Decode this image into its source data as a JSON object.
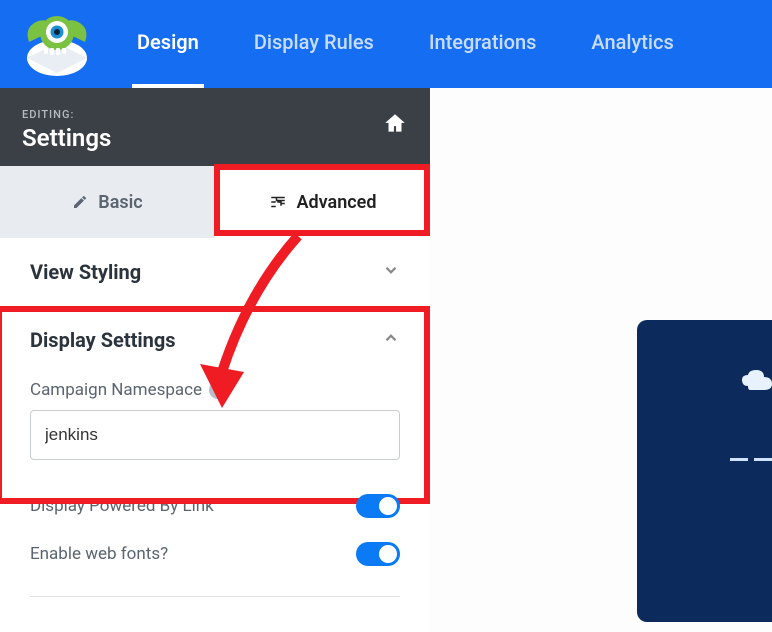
{
  "topnav": {
    "tabs": [
      "Design",
      "Display Rules",
      "Integrations",
      "Analytics"
    ],
    "active_index": 0
  },
  "editing": {
    "label": "EDITING:",
    "title": "Settings"
  },
  "subtabs": {
    "basic": "Basic",
    "advanced": "Advanced",
    "active": "advanced"
  },
  "sections": {
    "view_styling": {
      "title": "View Styling",
      "expanded": false
    },
    "display_settings": {
      "title": "Display Settings",
      "expanded": true,
      "campaign_namespace_label": "Campaign Namespace",
      "campaign_namespace_value": "jenkins",
      "display_powered_label": "Display Powered By Link",
      "display_powered_value": true,
      "enable_web_fonts_label": "Enable web fonts?",
      "enable_web_fonts_value": true
    }
  },
  "annotations": {
    "highlight_advanced": true,
    "highlight_display_settings": true,
    "arrow": true
  },
  "colors": {
    "primary": "#156df1",
    "highlight": "#ef1c24",
    "toggle_on": "#0a7bf5",
    "dark_panel": "#3b4047",
    "preview_bg": "#0c2a5c"
  }
}
